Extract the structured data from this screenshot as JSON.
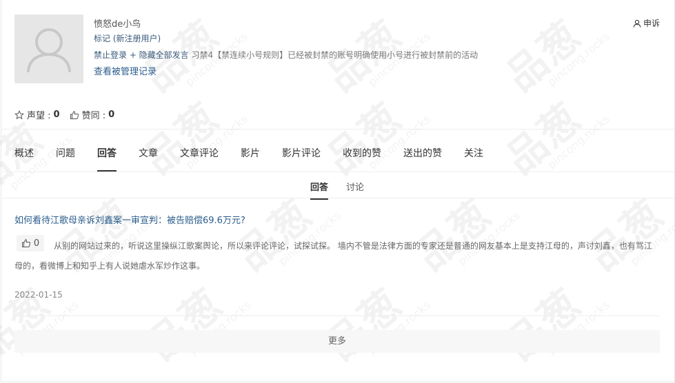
{
  "profile": {
    "username": "愤怒de小鸟",
    "tag": "标记 (新注册用户)",
    "ban_action": "禁止登录 + 隐藏全部发言",
    "ban_reason": "习禁4【禁连续小号规则】已经被封禁的账号明确使用小号进行被封禁前的活动",
    "management_link": "查看被管理记录",
    "appeal_label": "申诉"
  },
  "stats": {
    "reputation_label": "声望 :",
    "reputation_value": "0",
    "likes_label": "赞同 :",
    "likes_value": "0"
  },
  "tabs": [
    {
      "label": "概述"
    },
    {
      "label": "问题"
    },
    {
      "label": "回答"
    },
    {
      "label": "文章"
    },
    {
      "label": "文章评论"
    },
    {
      "label": "影片"
    },
    {
      "label": "影片评论"
    },
    {
      "label": "收到的赞"
    },
    {
      "label": "送出的赞"
    },
    {
      "label": "关注"
    }
  ],
  "active_tab": "回答",
  "subtabs": [
    {
      "label": "回答"
    },
    {
      "label": "讨论"
    }
  ],
  "answer": {
    "question_title": "如何看待江歌母亲诉刘鑫案一审宣判：被告赔偿69.6万元?",
    "vote_count": "0",
    "content": "从别的网站过来的，听说这里操纵江歌案舆论，所以来评论评论，试探试探。 墙内不管是法律方面的专家还是普通的网友基本上是支持江母的，声讨刘鑫，也有骂江母的，看微博上和知乎上有人说她虐水军炒作这事。",
    "date": "2022-01-15"
  },
  "more_label": "更多",
  "watermark": {
    "text_big": "品葱",
    "text_small": "pincong.rocks"
  },
  "colors": {
    "link": "#2b5d8c",
    "tag": "#3a5a7c",
    "text": "#333333",
    "muted": "#888888"
  }
}
